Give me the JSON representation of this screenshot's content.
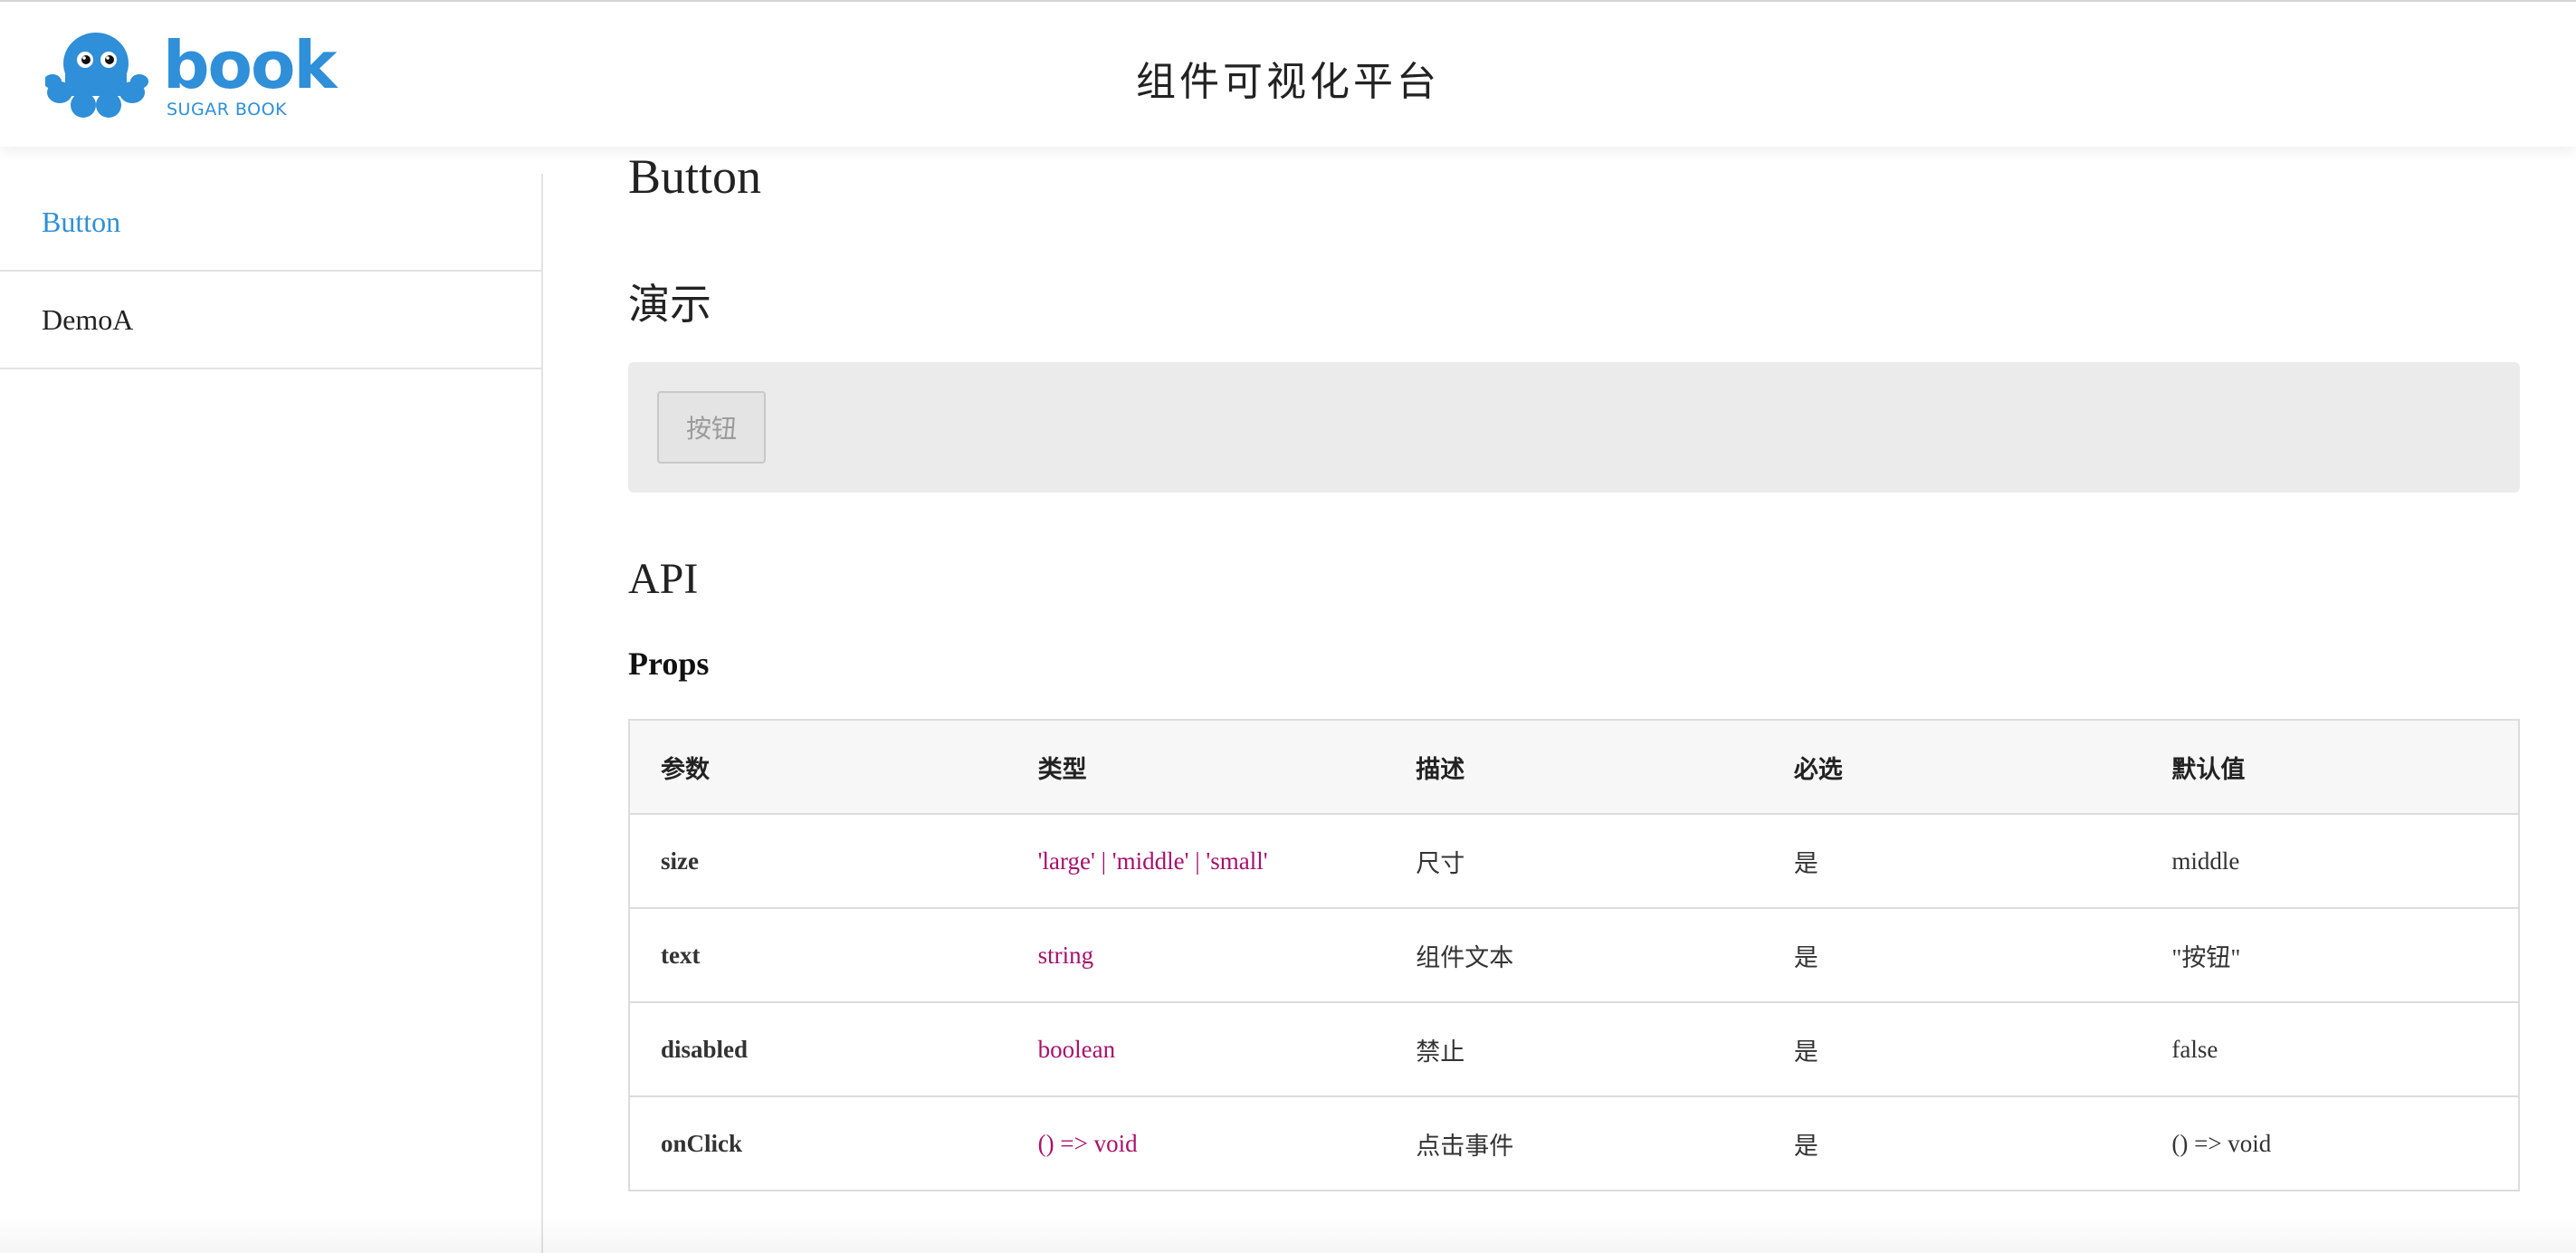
{
  "header": {
    "logo_word": "book",
    "logo_sub": "SUGAR BOOK",
    "title": "组件可视化平台"
  },
  "sidebar": {
    "items": [
      {
        "label": "Button",
        "active": true
      },
      {
        "label": "DemoA",
        "active": false
      }
    ]
  },
  "main": {
    "page_title": "Button",
    "demo_title": "演示",
    "demo_button_label": "按钮",
    "api_title": "API",
    "props_title": "Props",
    "table": {
      "headers": [
        "参数",
        "类型",
        "描述",
        "必选",
        "默认值"
      ],
      "rows": [
        [
          "size",
          "'large' | 'middle' | 'small'",
          "尺寸",
          "是",
          "middle"
        ],
        [
          "text",
          "string",
          "组件文本",
          "是",
          "\"按钮\""
        ],
        [
          "disabled",
          "boolean",
          "禁止",
          "是",
          "false"
        ],
        [
          "onClick",
          "() => void",
          "点击事件",
          "是",
          "() => void"
        ]
      ]
    }
  },
  "colors": {
    "accent": "#2f8fd8",
    "type_text": "#a8106b",
    "demo_bg": "#ebebeb"
  },
  "icons": {
    "logo": "octopus-logo-icon"
  }
}
